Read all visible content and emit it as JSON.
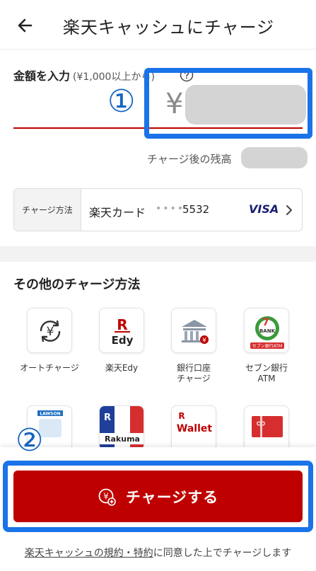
{
  "header": {
    "title": "楽天キャッシュにチャージ",
    "back_icon": "arrow-left-icon"
  },
  "amount": {
    "label": "金額を入力",
    "note": "(¥1,000以上から)",
    "currency_symbol": "¥",
    "annotation_number": "①"
  },
  "balance": {
    "label": "チャージ後の残高"
  },
  "payment_method": {
    "tag": "チャージ方法",
    "name": "楽天カード",
    "masked_digits": "••••",
    "last_digits": "5532",
    "brand": "VISA"
  },
  "other_methods": {
    "title": "その他のチャージ方法",
    "items": [
      {
        "label": "オートチャージ",
        "icon": "auto-charge-yen-icon"
      },
      {
        "label": "楽天Edy",
        "icon": "rakuten-edy-icon",
        "logo_top": "R",
        "logo_bottom": "Edy"
      },
      {
        "label": "銀行口座\nチャージ",
        "icon": "bank-icon"
      },
      {
        "label": "セブン銀行\nATM",
        "icon": "seven-bank-icon",
        "logo_text": "BANK",
        "logo_sub": "セブン銀行ATM"
      },
      {
        "label": "",
        "icon": "lawson-icon",
        "logo_text": "LAWSON"
      },
      {
        "label": "",
        "icon": "rakuma-icon",
        "logo_top": "R",
        "logo_bottom": "Rakuma"
      },
      {
        "label": "",
        "icon": "rakuten-wallet-icon",
        "logo_top": "R",
        "logo_bottom": "Wallet"
      },
      {
        "label": "",
        "icon": "gift-card-icon"
      }
    ]
  },
  "charge_button": {
    "label": "チャージする",
    "icon": "yen-charge-icon",
    "annotation_number": "②"
  },
  "terms": {
    "link_text": "楽天キャッシュの規約・特約",
    "rest_text": "に同意した上でチャージします"
  },
  "colors": {
    "brand_red": "#bf0000",
    "highlight_blue": "#1a73e8",
    "mask_gray": "#d4d4d4",
    "visa_navy": "#1a1f71"
  }
}
